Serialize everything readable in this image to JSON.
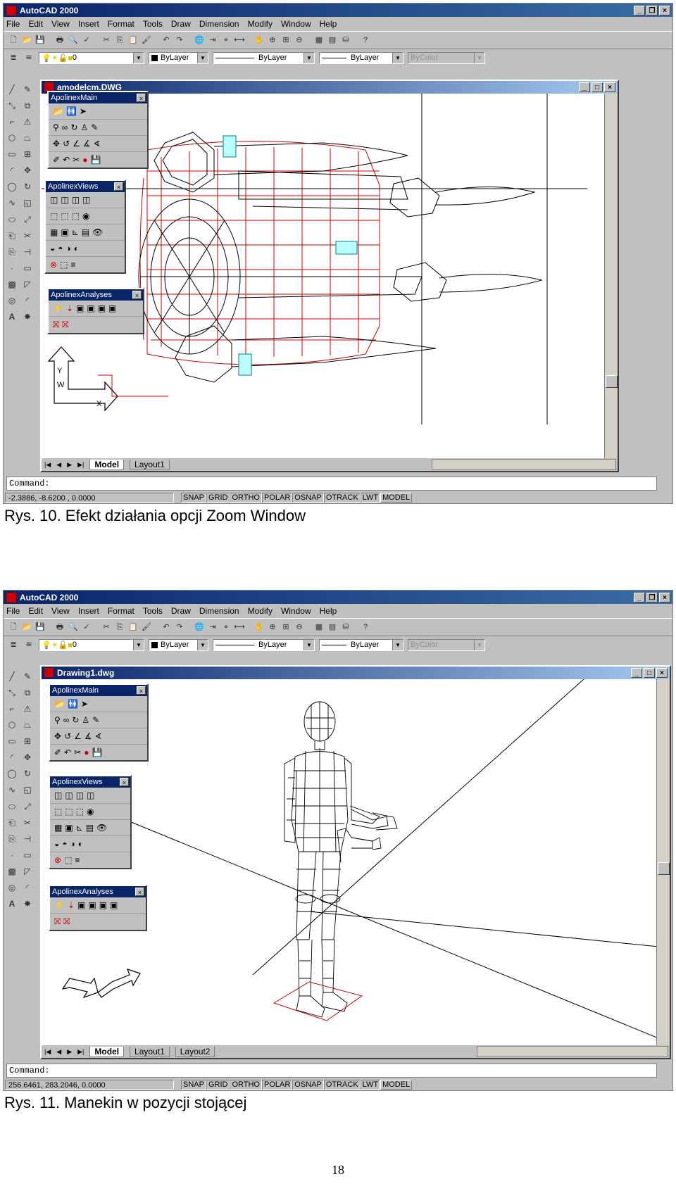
{
  "menu": [
    "File",
    "Edit",
    "View",
    "Insert",
    "Format",
    "Tools",
    "Draw",
    "Dimension",
    "Modify",
    "Window",
    "Help"
  ],
  "properties": {
    "layer": "0",
    "color": "ByLayer",
    "linetype": "ByLayer",
    "lineweight": "ByLayer",
    "plotstyle": "ByColor"
  },
  "palettes": {
    "main": "ApolinexMain",
    "views": "ApolinexViews",
    "analyses": "ApolinexAnalyses"
  },
  "command_prompt": "Command:",
  "status_toggles": [
    "SNAP",
    "GRID",
    "ORTHO",
    "POLAR",
    "OSNAP",
    "OTRACK",
    "LWT",
    "MODEL"
  ],
  "figures": [
    {
      "app_title": "AutoCAD 2000",
      "doc_title": "amodelcm.DWG",
      "tabs": [
        "Model",
        "Layout1"
      ],
      "coords": "-2.3886, -8.6200 , 0.0000",
      "caption": "Rys. 10. Efekt działania opcji Zoom Window"
    },
    {
      "app_title": "AutoCAD 2000",
      "doc_title": "Drawing1.dwg",
      "tabs": [
        "Model",
        "Layout1",
        "Layout2"
      ],
      "coords": "256.6461, 283.2046, 0.0000",
      "caption": "Rys. 11. Manekin w pozycji stojącej"
    }
  ],
  "page_number": "18"
}
